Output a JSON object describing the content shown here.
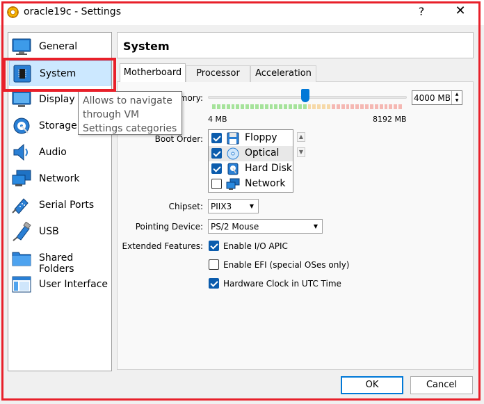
{
  "window": {
    "title": "oracle19c - Settings",
    "help_label": "?",
    "close_label": "✕"
  },
  "sidebar": {
    "items": [
      {
        "label": "General",
        "icon": "general-icon"
      },
      {
        "label": "System",
        "icon": "system-icon",
        "selected": true
      },
      {
        "label": "Display",
        "icon": "display-icon"
      },
      {
        "label": "Storage",
        "icon": "storage-icon"
      },
      {
        "label": "Audio",
        "icon": "audio-icon"
      },
      {
        "label": "Network",
        "icon": "network-icon"
      },
      {
        "label": "Serial Ports",
        "icon": "serial-ports-icon"
      },
      {
        "label": "USB",
        "icon": "usb-icon"
      },
      {
        "label": "Shared Folders",
        "icon": "shared-folders-icon"
      },
      {
        "label": "User Interface",
        "icon": "user-interface-icon"
      }
    ]
  },
  "tooltip": {
    "text": "Allows to navigate through VM Settings categories"
  },
  "page": {
    "title": "System"
  },
  "tabs": [
    {
      "label": "Motherboard",
      "active": true
    },
    {
      "label": "Processor"
    },
    {
      "label": "Acceleration"
    }
  ],
  "motherboard": {
    "memory": {
      "label": "Base Memory:",
      "label_visible": "mory:",
      "value": "4000 MB",
      "min_label": "4 MB",
      "max_label": "8192 MB",
      "slider_fraction": 0.49
    },
    "boot_order": {
      "label": "Boot Order:",
      "items": [
        {
          "label": "Floppy",
          "checked": true,
          "icon": "floppy-icon"
        },
        {
          "label": "Optical",
          "checked": true,
          "icon": "optical-disc-icon"
        },
        {
          "label": "Hard Disk",
          "checked": true,
          "icon": "hard-disk-icon"
        },
        {
          "label": "Network",
          "checked": false,
          "icon": "network-icon"
        }
      ],
      "up_label": "▲",
      "down_label": "▼"
    },
    "chipset": {
      "label": "Chipset:",
      "value": "PIIX3"
    },
    "pointing_device": {
      "label": "Pointing Device:",
      "value": "PS/2 Mouse"
    },
    "extended_features": {
      "label": "Extended Features:",
      "items": [
        {
          "label": "Enable I/O APIC",
          "checked": true
        },
        {
          "label": "Enable EFI (special OSes only)",
          "checked": false
        },
        {
          "label": "Hardware Clock in UTC Time",
          "checked": true
        }
      ]
    }
  },
  "buttons": {
    "ok": "OK",
    "cancel": "Cancel"
  },
  "colors": {
    "highlight": "#e8202a",
    "accent": "#0078d7",
    "selection": "#cce8ff"
  }
}
